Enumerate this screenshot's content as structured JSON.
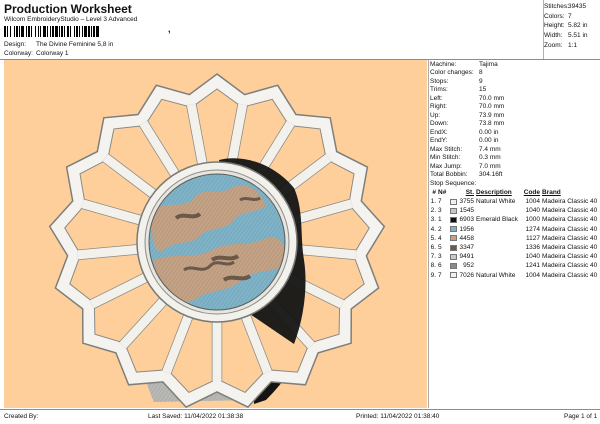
{
  "header": {
    "title": "Production Worksheet",
    "subtitle": "Wilcom EmbroideryStudio – Level 3 Advanced",
    "barcode_tail": ",",
    "design_label": "Design:",
    "design_value": "The Divine Feminine 5,8 in",
    "colorway_label": "Colorway:",
    "colorway_value": "Colorway 1"
  },
  "stats": [
    {
      "label": "Stitches:",
      "value": "39435"
    },
    {
      "label": "Colors:",
      "value": "7"
    },
    {
      "label": "Height:",
      "value": "5.82 in"
    },
    {
      "label": "Width:",
      "value": "5.51 in"
    },
    {
      "label": "Zoom:",
      "value": "1:1"
    }
  ],
  "machine_info": [
    {
      "label": "Machine:",
      "value": "Tajima"
    },
    {
      "label": "Color changes:",
      "value": "8"
    },
    {
      "label": "Stops:",
      "value": "9"
    },
    {
      "label": "Trims:",
      "value": "15"
    },
    {
      "label": "Left:",
      "value": "70.0 mm"
    },
    {
      "label": "Right:",
      "value": "70.0 mm"
    },
    {
      "label": "Up:",
      "value": "73.9 mm"
    },
    {
      "label": "Down:",
      "value": "73.8 mm"
    },
    {
      "label": "EndX:",
      "value": "0.00 in"
    },
    {
      "label": "EndY:",
      "value": "0.00 in"
    },
    {
      "label": "Max Stitch:",
      "value": "7.4 mm"
    },
    {
      "label": "Min Stitch:",
      "value": "0.3 mm"
    },
    {
      "label": "Max Jump:",
      "value": "7.0 mm"
    },
    {
      "label": "Total Bobbin:",
      "value": "304.16ft"
    }
  ],
  "stop_sequence": {
    "title": "Stop Sequence:",
    "headers": {
      "num": "#",
      "n": "N#",
      "st": "St.",
      "description": "Description",
      "code": "Code",
      "brand": "Brand"
    },
    "rows": [
      {
        "num": "1.",
        "n": "7",
        "st": "3755",
        "description": "Natural White",
        "code": "1004",
        "brand": "Madeira Classic 40",
        "color": "#f2f1ec"
      },
      {
        "num": "2.",
        "n": "3",
        "st": "1545",
        "description": "",
        "code": "1040",
        "brand": "Madeira Classic 40",
        "color": "#c9c9c4"
      },
      {
        "num": "3.",
        "n": "1",
        "st": "6903",
        "description": "Emerald Black",
        "code": "1000",
        "brand": "Madeira Classic 40",
        "color": "#111111"
      },
      {
        "num": "4.",
        "n": "2",
        "st": "1956",
        "description": "",
        "code": "1274",
        "brand": "Madeira Classic 40",
        "color": "#7fb3c8"
      },
      {
        "num": "5.",
        "n": "4",
        "st": "4458",
        "description": "",
        "code": "1127",
        "brand": "Madeira Classic 40",
        "color": "#c4a285"
      },
      {
        "num": "6.",
        "n": "5",
        "st": "3347",
        "description": "",
        "code": "1336",
        "brand": "Madeira Classic 40",
        "color": "#6d5a4a"
      },
      {
        "num": "7.",
        "n": "3",
        "st": "9491",
        "description": "",
        "code": "1040",
        "brand": "Madeira Classic 40",
        "color": "#c9c9c4"
      },
      {
        "num": "8.",
        "n": "6",
        "st": "952",
        "description": "",
        "code": "1241",
        "brand": "Madeira Classic 40",
        "color": "#8a8a88"
      },
      {
        "num": "9.",
        "n": "7",
        "st": "7026",
        "description": "Natural White",
        "code": "1004",
        "brand": "Madeira Classic 40",
        "color": "#f2f1ec"
      }
    ]
  },
  "canvas": {
    "background": "#ffcf9b"
  },
  "footer": {
    "created": "Created By:",
    "saved": "Last Saved: 11/04/2022 01:38:38",
    "printed": "Printed: 11/04/2022 01:38:40",
    "page": "Page 1 of 1"
  }
}
